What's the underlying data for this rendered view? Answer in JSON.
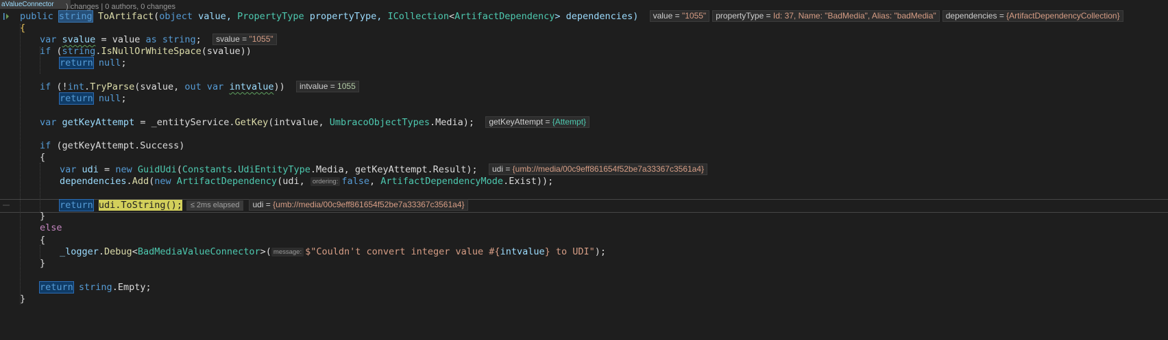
{
  "codelens": {
    "tab_label": "aValueConnector",
    "text": ") changes | 0 authors, 0 changes"
  },
  "lines": {
    "l1": {
      "kw_public": "public",
      "kw_string": "string",
      "method": "ToArtifact",
      "p1": "(",
      "kw_object": "object",
      "p_value": " value, ",
      "t_property": "PropertyType",
      "p_ptype": " propertyType, ",
      "t_icoll": "ICollection",
      "lt": "<",
      "t_artdep": "ArtifactDependency",
      "p_dep": "> dependencies)",
      "tips": [
        {
          "name": "value = ",
          "value": "\"1055\""
        },
        {
          "name": "propertyType = ",
          "value": "Id: 37, Name: \"BadMedia\", Alias: \"badMedia\""
        },
        {
          "name": "dependencies = ",
          "value": "{ArtifactDependencyCollection}"
        }
      ]
    },
    "l2": {
      "text": "{"
    },
    "l3": {
      "kw_var": "var",
      "name": "svalue",
      "rest1": " = value ",
      "kw_as": "as",
      "kw_string": "string",
      "end": ";",
      "tip_name": "svalue = ",
      "tip_value": "\"1055\""
    },
    "l4": {
      "kw_if": "if",
      "p": " (",
      "kw_string": "string",
      "dot": ".",
      "fn": "IsNullOrWhiteSpace",
      "rest": "(svalue))"
    },
    "l5": {
      "kw_return": "return",
      "kw_null": "null",
      "end": ";"
    },
    "l7": {
      "kw_if": "if",
      "p": " (!",
      "kw_int": "int",
      "dot": ".",
      "fn": "TryParse",
      "rest1": "(svalue, ",
      "kw_out": "out",
      "kw_var": "var",
      "name": "intvalue",
      "rest2": "))",
      "tip_name": "intvalue = ",
      "tip_value": "1055"
    },
    "l8": {
      "kw_return": "return",
      "kw_null": "null",
      "end": ";"
    },
    "l10": {
      "kw_var": "var",
      "name": "getKeyAttempt",
      "rest1": " = _entityService.",
      "fn": "GetKey",
      "rest2": "(intvalue, ",
      "ty": "UmbracoObjectTypes",
      "rest3": ".Media);",
      "tip_name": "getKeyAttempt = ",
      "tip_value": "{Attempt}"
    },
    "l12": {
      "kw_if": "if",
      "rest": " (getKeyAttempt.Success)"
    },
    "l13": {
      "text": "{"
    },
    "l14": {
      "kw_var": "var",
      "name": "udi",
      "rest1": " = ",
      "kw_new": "new",
      "ty": "GuidUdi",
      "rest2": "(",
      "ty2": "Constants",
      "dot": ".",
      "ty3": "UdiEntityType",
      "rest3": ".Media, getKeyAttempt.Result);",
      "tip_name": "udi = ",
      "tip_value": "{umb://media/00c9eff861654f52be7a33367c3561a4}"
    },
    "l15": {
      "name": "dependencies",
      "dot": ".",
      "fn": "Add",
      "p": "(",
      "kw_new": "new",
      "ty": "ArtifactDependency",
      "rest1": "(udi, ",
      "hint": "ordering:",
      "kw_false": "false",
      "rest2": ", ",
      "ty2": "ArtifactDependencyMode",
      "rest3": ".Exist));"
    },
    "l17": {
      "kw_return": "return",
      "stmt": "udi.ToString();",
      "elapsed": "≤ 2ms elapsed",
      "tip_name": "udi = ",
      "tip_value": "{umb://media/00c9eff861654f52be7a33367c3561a4}"
    },
    "l18": {
      "text": "}"
    },
    "l19": {
      "kw_else": "else"
    },
    "l20": {
      "text": "{"
    },
    "l21": {
      "name": "_logger",
      "dot": ".",
      "fn": "Debug",
      "lt": "<",
      "ty": "BadMediaValueConnector",
      "gt": ">(",
      "hint": "message:",
      "str1": "$\"Couldn't convert integer value #{",
      "interp": "intvalue",
      "str2": "} to UDI\"",
      "end": ");"
    },
    "l22": {
      "text": "}"
    },
    "l24": {
      "kw_return": "return",
      "kw_string": "string",
      "rest": ".Empty;"
    },
    "l25": {
      "text": "}"
    }
  }
}
